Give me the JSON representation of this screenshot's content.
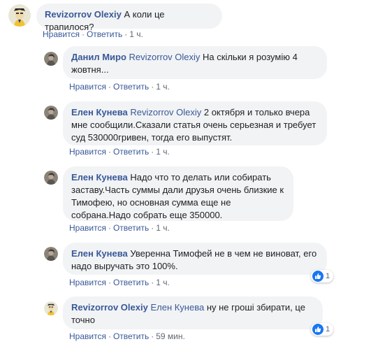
{
  "ui": {
    "like_label": "Нравится",
    "reply_label": "Ответить",
    "separator": "·"
  },
  "comments": [
    {
      "author": "Revizorrov Olexiy",
      "mention": "",
      "text": "А коли це трапилося?",
      "time": "1 ч.",
      "reactions": "",
      "avatar": "cartoon-avatar"
    },
    {
      "author": "Данил Миро",
      "mention": "Revizorrov Olexiy",
      "text": "На скільки я розумію 4 жовтня...",
      "time": "1 ч.",
      "reactions": "",
      "avatar": "photo-avatar"
    },
    {
      "author": "Елен Кунева",
      "mention": "Revizorrov Olexiy",
      "text": "2 октября и только вчера мне сообщили.Сказали статья очень серьезная и требует суд 530000гривен, тогда его выпустят.",
      "time": "1 ч.",
      "reactions": "",
      "avatar": "photo-avatar"
    },
    {
      "author": "Елен Кунева",
      "mention": "",
      "text": "Надо что то делать или собирать заставу.Часть суммы дали друзья очень близкие к Тимофею, но основная сумма еще не собрана.Надо собрать еще 350000.",
      "time": "1 ч.",
      "reactions": "",
      "avatar": "photo-avatar"
    },
    {
      "author": "Елен Кунева",
      "mention": "",
      "text": "Уверенна Тимофей не в чем не виноват, его надо выручать это 100%.",
      "time": "1 ч.",
      "reactions": "1",
      "avatar": "photo-avatar"
    },
    {
      "author": "Revizorrov Olexiy",
      "mention": "Елен Кунева",
      "text": "ну не гроші збирати, це точно",
      "time": "59 мин.",
      "reactions": "1",
      "avatar": "cartoon-avatar"
    }
  ],
  "colors": {
    "link": "#385898",
    "bubble": "#f2f3f5",
    "meta": "#606770",
    "like": "#1877f2"
  }
}
